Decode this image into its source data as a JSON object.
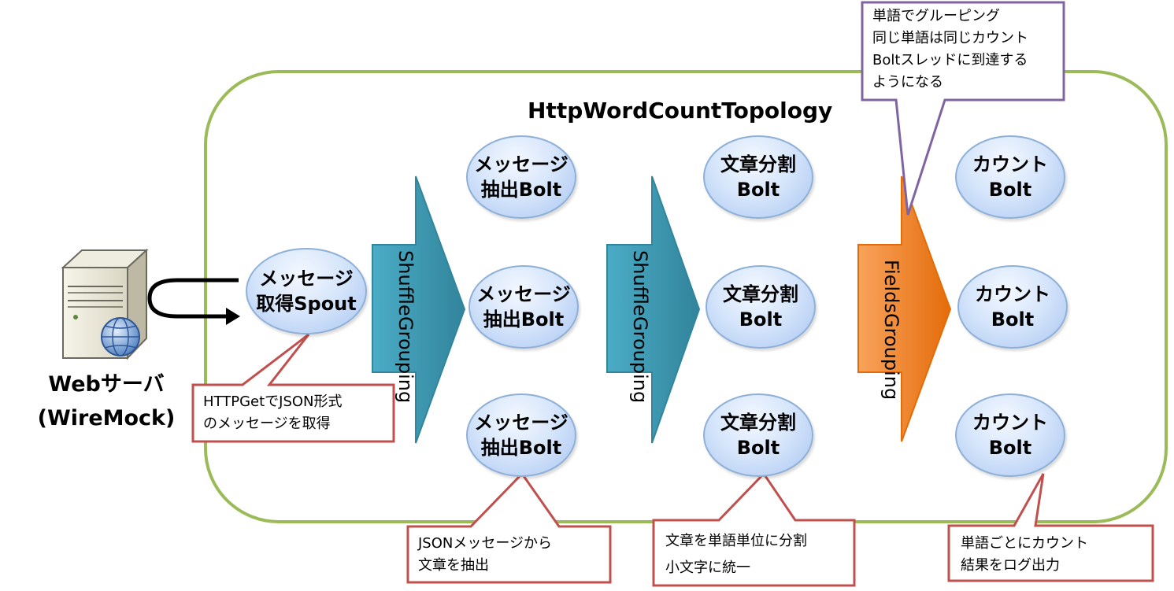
{
  "topology": {
    "title": "HttpWordCountTopology"
  },
  "server": {
    "name_line1": "Webサーバ",
    "name_line2": "(WireMock)"
  },
  "spout": {
    "line1": "メッセージ",
    "line2": "取得Spout"
  },
  "extract_bolts": [
    {
      "line1": "メッセージ",
      "line2": "抽出Bolt"
    },
    {
      "line1": "メッセージ",
      "line2": "抽出Bolt"
    },
    {
      "line1": "メッセージ",
      "line2": "抽出Bolt"
    }
  ],
  "split_bolts": [
    {
      "line1": "文章分割",
      "line2": "Bolt"
    },
    {
      "line1": "文章分割",
      "line2": "Bolt"
    },
    {
      "line1": "文章分割",
      "line2": "Bolt"
    }
  ],
  "count_bolts": [
    {
      "line1": "カウント",
      "line2": "Bolt"
    },
    {
      "line1": "カウント",
      "line2": "Bolt"
    },
    {
      "line1": "カウント",
      "line2": "Bolt"
    }
  ],
  "groupings": {
    "shuffle1": {
      "line1": "Shuffle",
      "line2": "Grouping"
    },
    "shuffle2": {
      "line1": "Shuffle",
      "line2": "Grouping"
    },
    "fields": {
      "line1": "Fields",
      "line2": "Grouping"
    }
  },
  "callouts": {
    "spout_note": {
      "line1": "HTTPGetでJSON形式",
      "line2": "のメッセージを取得"
    },
    "extract_note": {
      "line1": "JSONメッセージから",
      "line2": "文章を抽出"
    },
    "split_note": {
      "line1": "文章を単語単位に分割",
      "line2": "小文字に統一"
    },
    "count_note": {
      "line1": "単語ごとにカウント",
      "line2": "結果をログ出力"
    },
    "fields_note": {
      "line1": "単語でグルーピング",
      "line2": "同じ単語は同じカウント",
      "line3": "Boltスレッドに到達する",
      "line4": "ようになる"
    }
  },
  "colors": {
    "topology_border": "#9bbb59",
    "shuffle_arrow": "#4bacc6",
    "fields_arrow": "#f79646",
    "red_callout_border": "#c0504d",
    "purple_callout_border": "#8064a2",
    "node_fill": "#c6dbf7"
  }
}
